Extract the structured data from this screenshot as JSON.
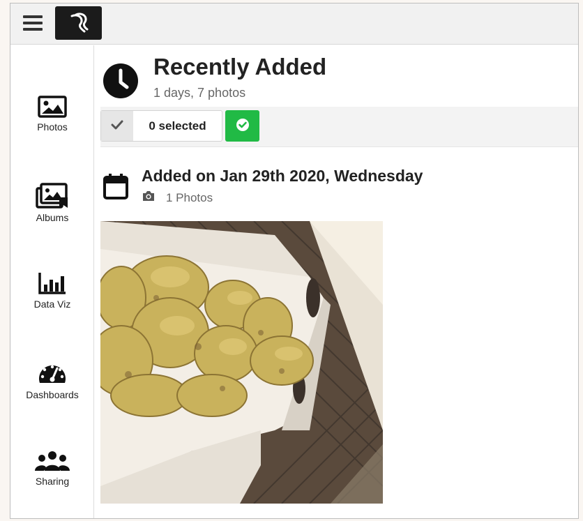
{
  "header": {
    "menu_icon": "hamburger-icon",
    "logo_icon": "app-logo-icon"
  },
  "sidebar": {
    "items": [
      {
        "label": "Photos",
        "icon": "image-icon"
      },
      {
        "label": "Albums",
        "icon": "albums-icon"
      },
      {
        "label": "Data Viz",
        "icon": "bar-chart-icon"
      },
      {
        "label": "Dashboards",
        "icon": "gauge-icon"
      },
      {
        "label": "Sharing",
        "icon": "users-icon"
      }
    ]
  },
  "main": {
    "title": "Recently Added",
    "subtitle": "1 days, 7 photos",
    "title_icon": "clock-icon",
    "selection": {
      "count_label": "0 selected",
      "toggle_icon": "checkmark-icon",
      "confirm_icon": "check-circle-icon",
      "confirm_color": "#21ba45"
    },
    "groups": [
      {
        "title": "Added on Jan 29th 2020, Wednesday",
        "count_label": "1 Photos",
        "icon": "calendar-icon",
        "count_icon": "camera-icon",
        "photos": [
          {
            "description_icon": "fried-food-photo"
          }
        ]
      }
    ]
  },
  "colors": {
    "accent_green": "#21ba45",
    "logo_bg": "#1b1b1b",
    "topbar_bg": "#f1f1f1"
  }
}
